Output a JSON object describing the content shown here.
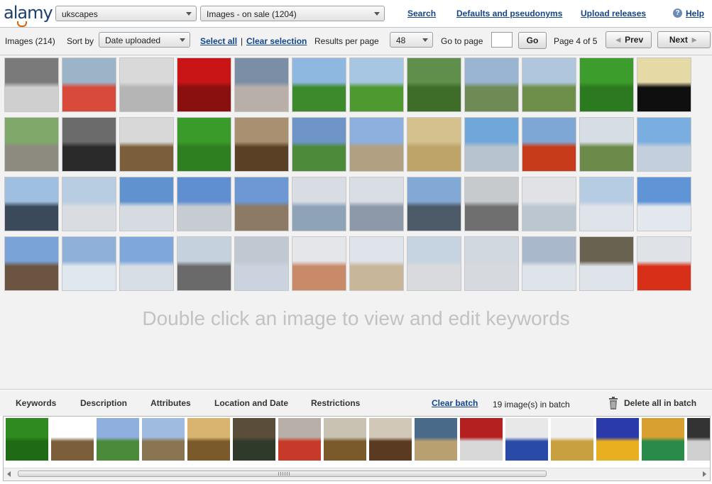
{
  "app": {
    "logo_text": "alamy",
    "brand_color": "#1d3f6d",
    "accent_color": "#e06000"
  },
  "header": {
    "account_select": "ukscapes",
    "filter_select": "Images - on sale (1204)",
    "links": {
      "search": "Search",
      "defaults": "Defaults and pseudonyms",
      "upload": "Upload releases",
      "help": "Help"
    }
  },
  "toolbar": {
    "images_count": "Images (214)",
    "sort_label": "Sort by",
    "sort_value": "Date uploaded",
    "select_all": "Select all",
    "separator": "|",
    "clear_selection": "Clear selection",
    "results_label": "Results per page",
    "results_value": "48",
    "goto_label": "Go to page",
    "goto_value": "",
    "go_button": "Go",
    "page_info": "Page 4 of 5",
    "prev_button": "Prev",
    "next_button": "Next"
  },
  "grid": {
    "hint": "Double click an image to view and edit keywords",
    "thumbnails": [
      {
        "t": "#7a7a7a",
        "b": "#cfcfcf"
      },
      {
        "t": "#9cb4c8",
        "b": "#d84a3a"
      },
      {
        "t": "#d9d9d9",
        "b": "#b5b5b5"
      },
      {
        "t": "#c91515",
        "b": "#8a1010"
      },
      {
        "t": "#7c8ea6",
        "b": "#b8b0a8"
      },
      {
        "t": "#8fb8e0",
        "b": "#3d8a2c"
      },
      {
        "t": "#a7c6e2",
        "b": "#4f9a30"
      },
      {
        "t": "#5f8f4a",
        "b": "#3e6d2a"
      },
      {
        "t": "#9ab5d2",
        "b": "#6f8a55"
      },
      {
        "t": "#b0c6dc",
        "b": "#6d8f4a"
      },
      {
        "t": "#3d9d2c",
        "b": "#2c7a20"
      },
      {
        "t": "#e5d9a6",
        "b": "#0f0f0f"
      },
      {
        "t": "#7fa86a",
        "b": "#8d8a7f"
      },
      {
        "t": "#6b6b6b",
        "b": "#2a2a2a"
      },
      {
        "t": "#d8d8d8",
        "b": "#7a5f3a"
      },
      {
        "t": "#3a9a2a",
        "b": "#2d7f1f"
      },
      {
        "t": "#a89070",
        "b": "#5a4025"
      },
      {
        "t": "#6f95c8",
        "b": "#4d8a3a"
      },
      {
        "t": "#8db0de",
        "b": "#b1a082"
      },
      {
        "t": "#d4c18e",
        "b": "#bfa46a"
      },
      {
        "t": "#6fa7da",
        "b": "#b7c3cf"
      },
      {
        "t": "#7fa7d6",
        "b": "#c73a1a"
      },
      {
        "t": "#d7dde4",
        "b": "#6c8a4a"
      },
      {
        "t": "#7aaee0",
        "b": "#c3cfdc"
      },
      {
        "t": "#9fbfe0",
        "b": "#3a4a5a"
      },
      {
        "t": "#b8cde2",
        "b": "#d9dde2"
      },
      {
        "t": "#5f92cf",
        "b": "#d6dbe2"
      },
      {
        "t": "#5f8fd0",
        "b": "#c7cbd2"
      },
      {
        "t": "#6d98d4",
        "b": "#8c7a64"
      },
      {
        "t": "#d8dde3",
        "b": "#8ea2b8"
      },
      {
        "t": "#d9dde4",
        "b": "#8d98a8"
      },
      {
        "t": "#82a9d6",
        "b": "#4d5a68"
      },
      {
        "t": "#c7cacc",
        "b": "#6f6f6f"
      },
      {
        "t": "#e0e2e6",
        "b": "#bcc6d0"
      },
      {
        "t": "#b6cce2",
        "b": "#dfe4ea"
      },
      {
        "t": "#5f95d6",
        "b": "#e3e8ee"
      },
      {
        "t": "#7aa3d8",
        "b": "#6b5540"
      },
      {
        "t": "#8fb0d8",
        "b": "#dfe7ef"
      },
      {
        "t": "#7fa7dc",
        "b": "#d8dee6"
      },
      {
        "t": "#c5d2de",
        "b": "#6a6a6a"
      },
      {
        "t": "#c0c8d2",
        "b": "#cbd4de"
      },
      {
        "t": "#e4e6ea",
        "b": "#c98a6a"
      },
      {
        "t": "#dfe4ea",
        "b": "#c8b69a"
      },
      {
        "t": "#c6d3e0",
        "b": "#d8dadd"
      },
      {
        "t": "#d2d8e0",
        "b": "#d6d9dd"
      },
      {
        "t": "#aab8cb",
        "b": "#dfe4ea"
      },
      {
        "t": "#6a6250",
        "b": "#dfe3ea"
      },
      {
        "t": "#dfe3e8",
        "b": "#d83018"
      }
    ]
  },
  "batch": {
    "tabs": [
      "Keywords",
      "Description",
      "Attributes",
      "Location and Date",
      "Restrictions"
    ],
    "clear_batch": "Clear batch",
    "batch_count": "19 image(s) in batch",
    "delete_all": "Delete all in batch",
    "thumbnails": [
      {
        "t": "#2f8a1f",
        "b": "#1f6a14"
      },
      {
        "t": "#ffffff",
        "b": "#7a5f3a"
      },
      {
        "t": "#8fb0de",
        "b": "#4a8a3a"
      },
      {
        "t": "#9fbbe0",
        "b": "#8a7552"
      },
      {
        "t": "#d8b470",
        "b": "#7a5a2a"
      },
      {
        "t": "#5a4d3a",
        "b": "#2f3a2a"
      },
      {
        "t": "#b8b0a8",
        "b": "#c73a2a"
      },
      {
        "t": "#c8c2b2",
        "b": "#7a5a2a"
      },
      {
        "t": "#d2c8b8",
        "b": "#5a3a20"
      },
      {
        "t": "#4a6a8a",
        "b": "#b8a070"
      },
      {
        "t": "#b42020",
        "b": "#d8d8d8"
      },
      {
        "t": "#e8e8e8",
        "b": "#2a4aa8"
      },
      {
        "t": "#f0f0f0",
        "b": "#c9a040"
      },
      {
        "t": "#2a3aa8",
        "b": "#e8b020"
      },
      {
        "t": "#d8a030",
        "b": "#2a8a4a"
      },
      {
        "t": "#333333",
        "b": "#d0d0d0"
      }
    ],
    "scroll_fraction": 0.78
  }
}
